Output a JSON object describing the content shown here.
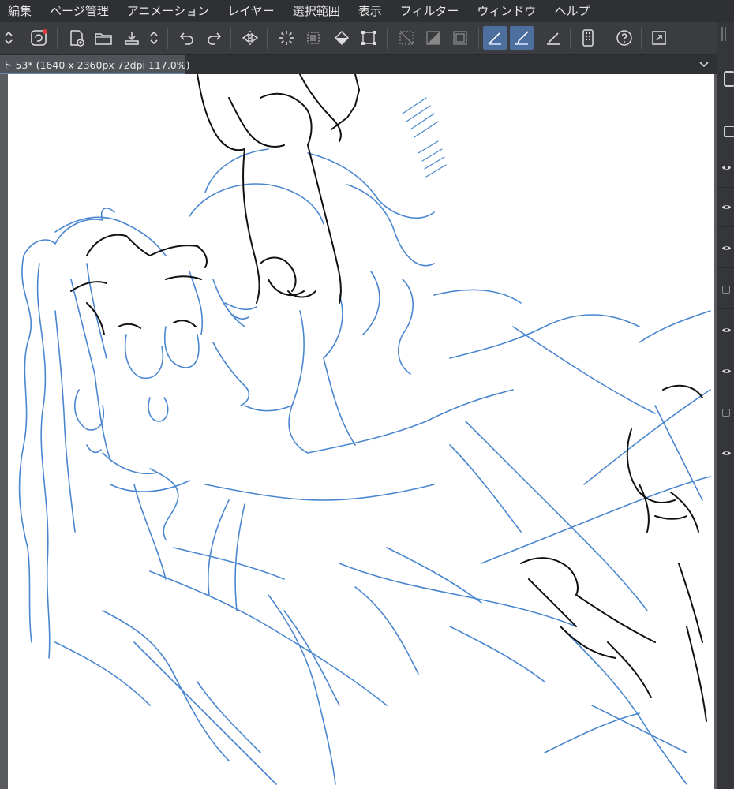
{
  "menu": [
    "編集",
    "ページ管理",
    "アニメーション",
    "レイヤー",
    "選択範囲",
    "表示",
    "フィルター",
    "ウィンドウ",
    "ヘルプ"
  ],
  "tab": {
    "label": "ト 53* (1640 x 2360px 72dpi 117.0%)"
  },
  "toolbar_icons": [
    "stepper-icon",
    "clip-studio-icon",
    "new-file-icon",
    "open-folder-icon",
    "save-icon",
    "stepper-icon",
    "undo-icon",
    "redo-icon",
    "flip-horizontal-icon",
    "loading-spinner-icon",
    "select-all-icon",
    "fill-icon",
    "transform-icon",
    "deselect-icon",
    "invert-selection-icon",
    "show-selection-icon",
    "ruler-snap-icon",
    "brush-snap-icon",
    "pen-snap-icon",
    "tablet-icon",
    "help-icon",
    "fullscreen-icon"
  ],
  "colors": {
    "sketch_blue": "#4a86cf",
    "sketch_black": "#111111",
    "accent": "#4d6fa0"
  }
}
